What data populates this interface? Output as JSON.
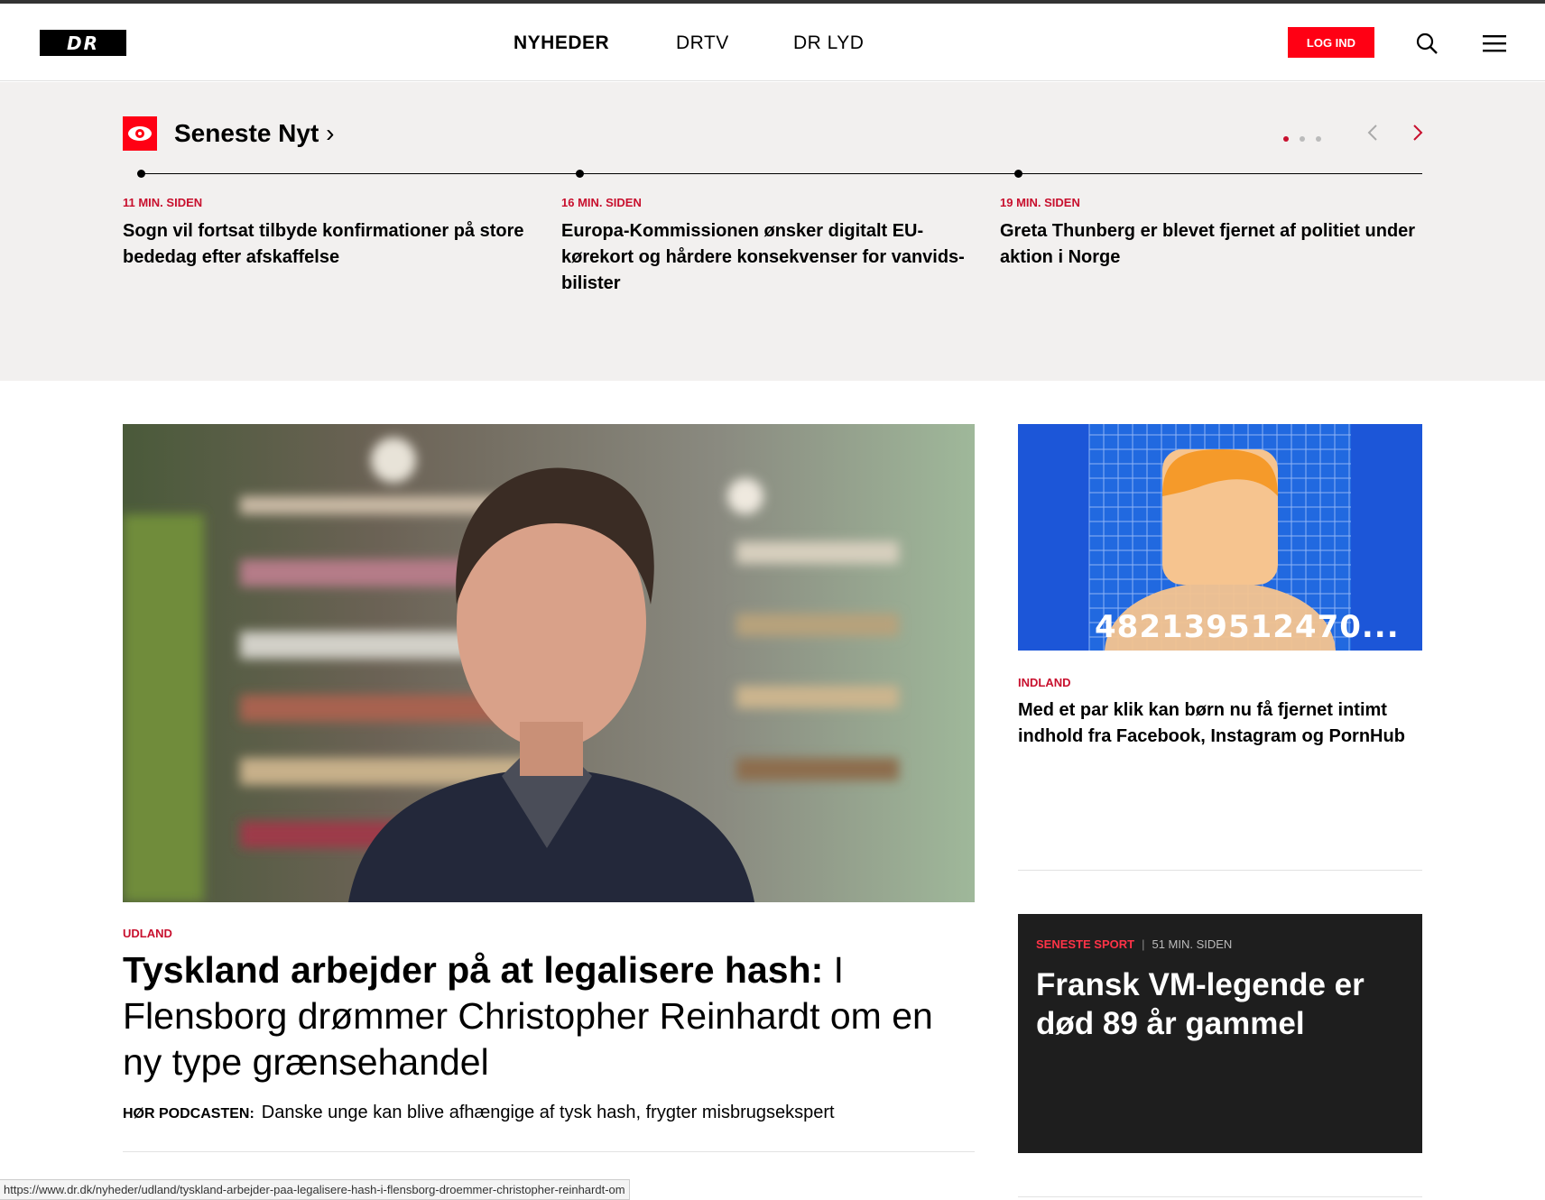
{
  "header": {
    "logo": "DR",
    "nav": [
      "NYHEDER",
      "DRTV",
      "DR LYD"
    ],
    "login_label": "LOG IND"
  },
  "seneste": {
    "title": "Seneste Nyt",
    "items": [
      {
        "time": "11 MIN. SIDEN",
        "headline": "Sogn vil fortsat tilbyde konfirmationer på store bededag efter afskaffelse"
      },
      {
        "time": "16 MIN. SIDEN",
        "headline": "Europa-Kommissionen ønsker digitalt EU-kørekort og hårdere konsekvenser for vanvids-bilister"
      },
      {
        "time": "19 MIN. SIDEN",
        "headline": "Greta Thunberg er blevet fjernet af politiet under aktion i Norge"
      }
    ]
  },
  "hero": {
    "tag": "UDLAND",
    "title_bold": "Tyskland arbejder på at legalisere hash:",
    "title_rest": " I Flensborg drømmer Christopher Reinhardt om en ny type grænsehandel",
    "podcast_label": "HØR PODCASTEN:",
    "podcast_text": "Danske unge kan blive afhængige af tysk hash, frygter misbrugsekspert"
  },
  "side": {
    "image_number": "482139512470...",
    "tag": "INDLAND",
    "headline": "Med et par klik kan børn nu få fjernet intimt indhold fra Facebook, Instagram og PornHub"
  },
  "sport": {
    "label": "SENESTE SPORT",
    "time": "51 MIN. SIDEN",
    "headline": "Fransk VM-legende er død 89 år gammel"
  },
  "status_url": "https://www.dr.dk/nyheder/udland/tyskland-arbejder-paa-legalisere-hash-i-flensborg-droemmer-christopher-reinhardt-om"
}
